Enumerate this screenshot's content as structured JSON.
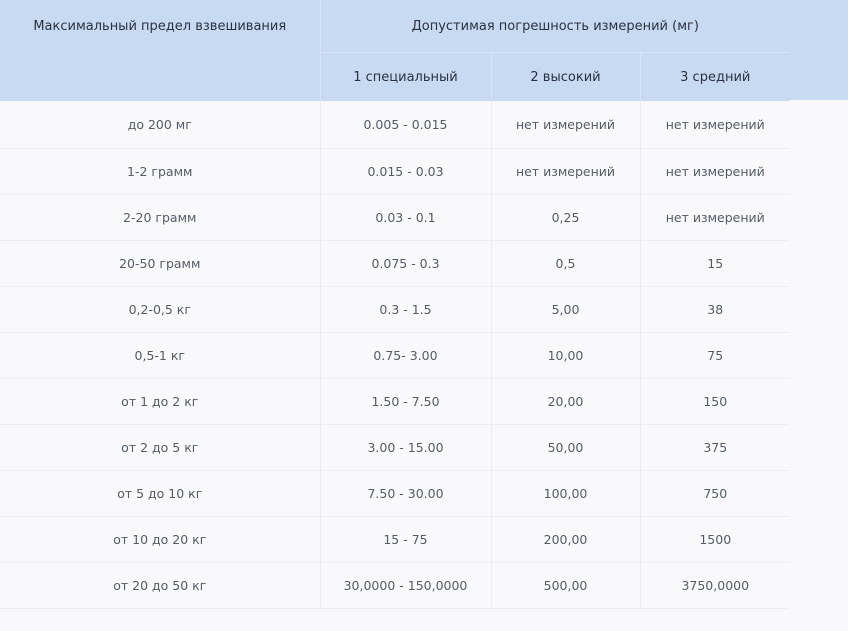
{
  "table": {
    "header": {
      "col1": "Максимальный предел взвешивания",
      "group": "Допустимая погрешность измерений (мг)",
      "sub": [
        "1 специальный",
        "2 высокий",
        "3 средний"
      ]
    },
    "rows": [
      [
        "до 200 мг",
        "0.005 - 0.015",
        "нет измерений",
        "нет измерений"
      ],
      [
        "1-2 грамм",
        "0.015 - 0.03",
        "нет измерений",
        "нет измерений"
      ],
      [
        "2-20 грамм",
        "0.03 - 0.1",
        "0,25",
        "нет измерений"
      ],
      [
        "20-50 грамм",
        "0.075 - 0.3",
        "0,5",
        "15"
      ],
      [
        "0,2-0,5 кг",
        "0.3 - 1.5",
        "5,00",
        "38"
      ],
      [
        "0,5-1 кг",
        "0.75- 3.00",
        "10,00",
        "75"
      ],
      [
        "от 1 до 2 кг",
        "1.50 - 7.50",
        "20,00",
        "150"
      ],
      [
        "от 2 до 5 кг",
        "3.00 - 15.00",
        "50,00",
        "375"
      ],
      [
        "от 5 до 10 кг",
        "7.50 - 30.00",
        "100,00",
        "750"
      ],
      [
        "от 10 до 20 кг",
        "15 - 75",
        "200,00",
        "1500"
      ],
      [
        "от 20 до 50 кг",
        "30,0000 - 150,0000",
        "500,00",
        "3750,0000"
      ]
    ]
  }
}
